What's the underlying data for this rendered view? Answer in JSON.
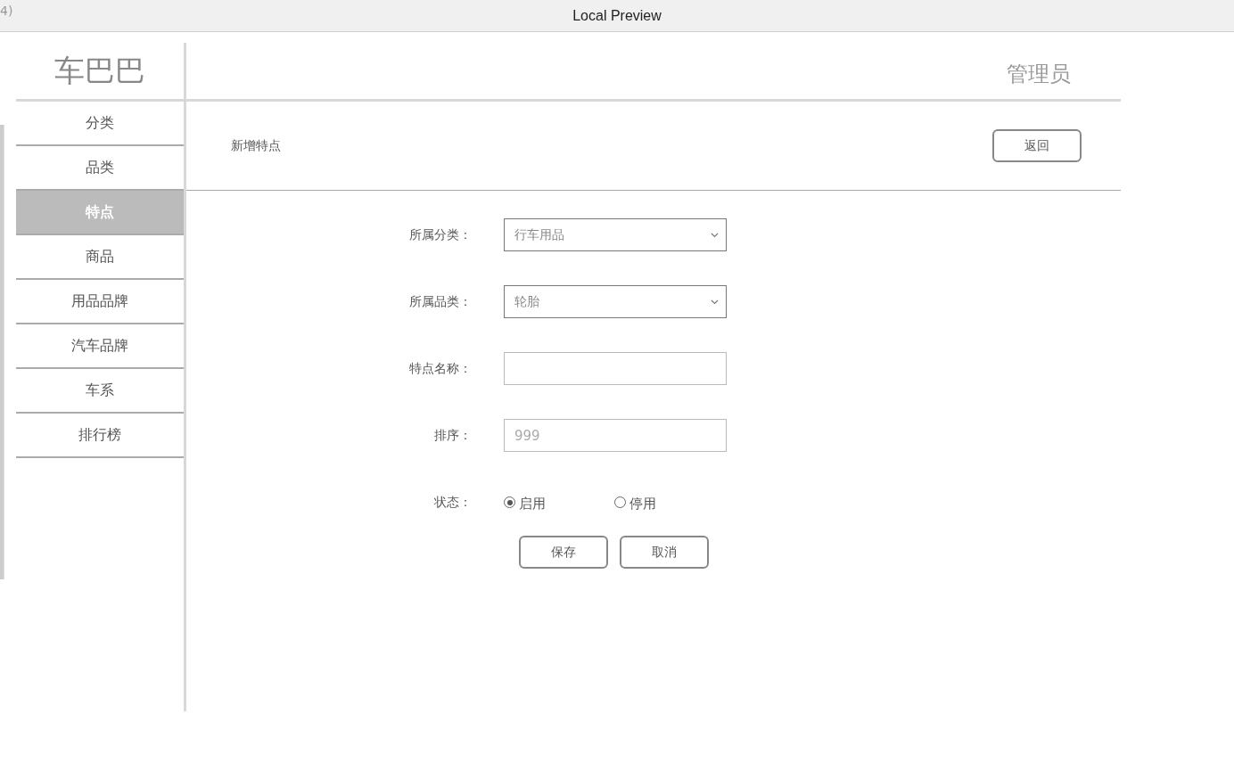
{
  "window": {
    "title": "Local Preview",
    "corner_text": "4)"
  },
  "sidebar": {
    "logo": "车巴巴",
    "items": [
      {
        "label": "分类",
        "selected": false
      },
      {
        "label": "品类",
        "selected": false
      },
      {
        "label": "特点",
        "selected": true
      },
      {
        "label": "商品",
        "selected": false
      },
      {
        "label": "用品品牌",
        "selected": false
      },
      {
        "label": "汽车品牌",
        "selected": false
      },
      {
        "label": "车系",
        "selected": false
      },
      {
        "label": "排行榜",
        "selected": false
      }
    ]
  },
  "header": {
    "user": "管理员"
  },
  "page": {
    "title": "新增特点",
    "back_button": "返回"
  },
  "form": {
    "fields": [
      {
        "kind": "select",
        "label": "所属分类：",
        "value": "行车用品"
      },
      {
        "kind": "select",
        "label": "所属品类：",
        "value": "轮胎"
      },
      {
        "kind": "text",
        "label": "特点名称："
      },
      {
        "kind": "text",
        "label": "排序：",
        "placeholder": "999"
      },
      {
        "kind": "radio",
        "label": "状态：",
        "options": [
          {
            "label": "启用",
            "selected": true
          },
          {
            "label": "停用",
            "selected": false
          }
        ]
      }
    ],
    "buttons": [
      "保存",
      "取消"
    ]
  }
}
